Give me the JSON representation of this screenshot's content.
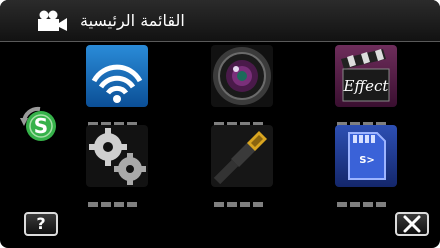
{
  "header": {
    "title": "القائمة الرئيسية",
    "icon": "video-camera-icon"
  },
  "side": {
    "icon": "mode-switch-icon",
    "accent": "#3cb44b"
  },
  "grid": [
    {
      "icon": "wifi-icon",
      "name": "wifi"
    },
    {
      "icon": "camera-lens-icon",
      "name": "recording"
    },
    {
      "icon": "effect-clapperboard-icon",
      "name": "effect"
    },
    {
      "icon": "gears-icon",
      "name": "settings"
    },
    {
      "icon": "hdmi-cable-icon",
      "name": "connection"
    },
    {
      "icon": "sd-card-icon",
      "name": "media"
    }
  ],
  "buttons": {
    "help_label": "?",
    "close_icon": "close-icon"
  }
}
